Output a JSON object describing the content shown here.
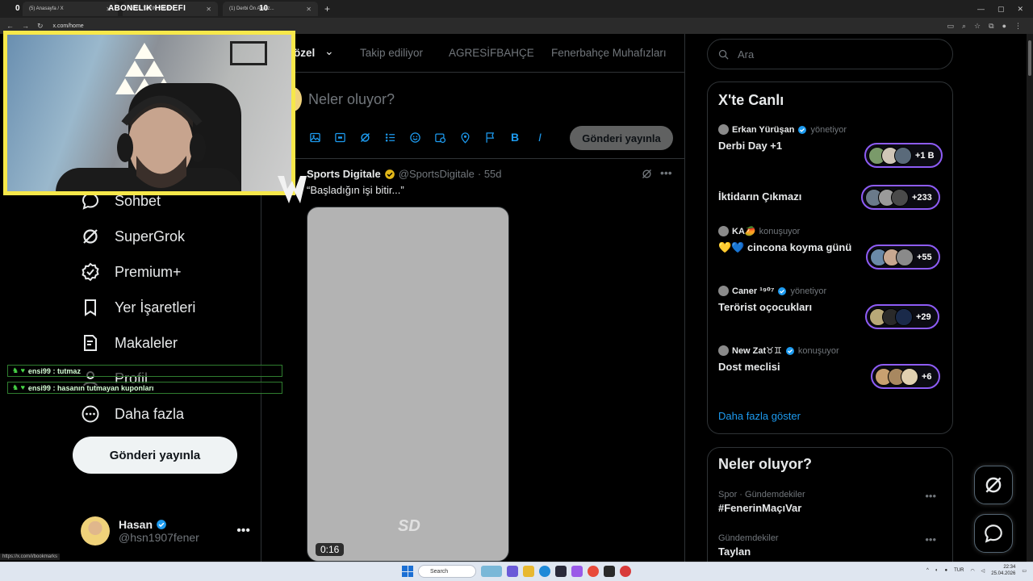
{
  "browser": {
    "tabs": [
      {
        "label": "(5) Anasayfa / X"
      },
      {
        "label": "ÖZEL YAYIN: SIDEN"
      },
      {
        "label": "(1) Derbi Ön Analiz..."
      }
    ],
    "url": "x.com/home",
    "status_url": "https://x.com/i/bookmarks"
  },
  "stream_overlay": {
    "left_count": "0",
    "title": "ABONELIK HEDEFI",
    "right_count": "10",
    "chat": [
      {
        "user": "ensi99",
        "message": "tutmaz",
        "line": "ensi99 : tutmaz"
      },
      {
        "user": "ensi99",
        "message": "hasanın tutmayan kuponları",
        "line": "ensi99 : hasanın tutmayan kuponları"
      }
    ]
  },
  "sidebar": {
    "items": [
      {
        "label": "Sohbet",
        "icon": "chat-icon"
      },
      {
        "label": "SuperGrok",
        "icon": "grok-icon"
      },
      {
        "label": "Premium+",
        "icon": "verified-icon"
      },
      {
        "label": "Yer İşaretleri",
        "icon": "bookmark-icon"
      },
      {
        "label": "Makaleler",
        "icon": "article-icon"
      },
      {
        "label": "Profil",
        "icon": "profile-icon"
      },
      {
        "label": "Daha fazla",
        "icon": "more-circle-icon"
      }
    ],
    "post_button": "Gönderi yayınla",
    "account": {
      "name": "Hasan",
      "handle": "@hsn1907fener"
    }
  },
  "timeline": {
    "tabs": [
      {
        "label": "n özel",
        "active": true
      },
      {
        "label": "Takip ediliyor",
        "active": false
      },
      {
        "label": "AGRESİFBAHÇE",
        "active": false
      },
      {
        "label": "Fenerbahçe Muhafızları",
        "active": false
      }
    ],
    "composer": {
      "placeholder": "Neler oluyor?",
      "post_button": "Gönderi yayınla"
    },
    "post": {
      "name": "Sports Digitale",
      "handle": "@SportsDigitale",
      "time": "· 55d",
      "text": "“Başladığın işi bitir...”",
      "watermark": "SD",
      "duration": "0:16"
    }
  },
  "right": {
    "search_placeholder": "Ara",
    "live": {
      "title": "X'te Canlı",
      "spaces": [
        {
          "host": "Erkan Yürüşan",
          "role": "yönetiyor",
          "title": "Derbi Day +1",
          "count": "+1 B"
        },
        {
          "host": "",
          "role": "",
          "title": "İktidarın Çıkmazı",
          "count": "+233"
        },
        {
          "host": "KA🥭",
          "role": "konuşuyor",
          "title": "💛💙 cincona koyma günü",
          "count": "+55"
        },
        {
          "host": "Caner ¹⁹⁰⁷",
          "role": "yönetiyor",
          "title": "Terörist oçocukları",
          "count": "+29"
        },
        {
          "host": "New Zat♉♊",
          "role": "konuşuyor",
          "title": "Dost meclisi",
          "count": "+6"
        }
      ],
      "more": "Daha fazla göster"
    },
    "trends": {
      "title": "Neler oluyor?",
      "items": [
        {
          "category": "Spor · Gündemdekiler",
          "name": "#FenerinMaçıVar"
        },
        {
          "category": "Gündemdekiler",
          "name": "Taylan"
        }
      ]
    }
  },
  "taskbar": {
    "search": "Search",
    "lang": "TUR",
    "time": "22:34",
    "date": "25.04.2026"
  },
  "colors": {
    "accent": "#1d9bf0",
    "live_border": "#8e5cf6",
    "webcam_border": "#f7e84a"
  }
}
